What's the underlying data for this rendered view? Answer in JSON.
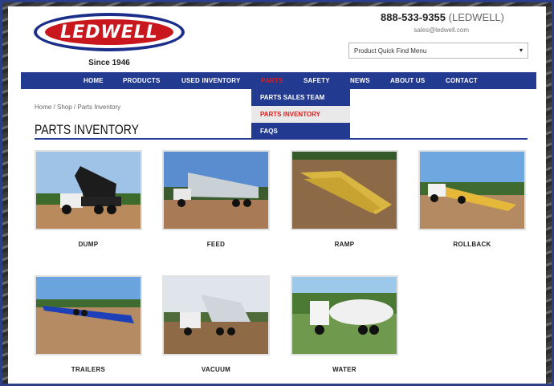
{
  "header": {
    "logo_text": "LEDWELL",
    "since": "Since 1946",
    "phone": "888-533-9355",
    "phone_suffix": "(LEDWELL)",
    "email": "sales@ledwell.com",
    "quick_find": "Product Quick Find Menu"
  },
  "nav": {
    "items": [
      {
        "label": "HOME"
      },
      {
        "label": "PRODUCTS"
      },
      {
        "label": "USED INVENTORY"
      },
      {
        "label": "PARTS"
      },
      {
        "label": "SAFETY"
      },
      {
        "label": "NEWS"
      },
      {
        "label": "ABOUT US"
      },
      {
        "label": "CONTACT"
      }
    ],
    "dropdown": [
      "PARTS SALES TEAM",
      "PARTS INVENTORY",
      "FAQS"
    ]
  },
  "breadcrumb": "Home / Shop / Parts Inventory",
  "page_title": "PARTS INVENTORY",
  "categories": [
    {
      "label": "DUMP"
    },
    {
      "label": "FEED"
    },
    {
      "label": "RAMP"
    },
    {
      "label": "ROLLBACK"
    },
    {
      "label": "TRAILERS"
    },
    {
      "label": "VACUUM"
    },
    {
      "label": "WATER"
    }
  ],
  "colors": {
    "brand_blue": "#223b90",
    "brand_red": "#c8181e",
    "active_red": "#e01d1d"
  }
}
